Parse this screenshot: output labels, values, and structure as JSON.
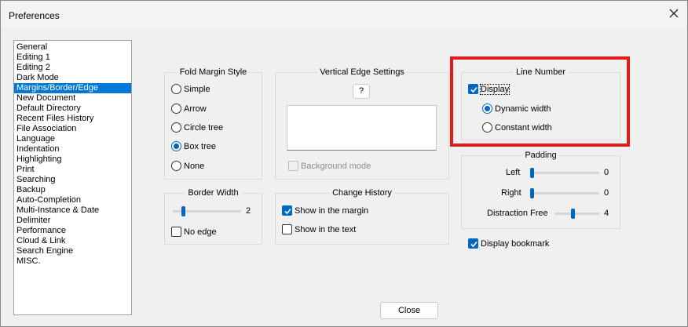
{
  "window": {
    "title": "Preferences"
  },
  "sidebar": {
    "items": [
      {
        "label": "General",
        "selected": false
      },
      {
        "label": "Editing 1",
        "selected": false
      },
      {
        "label": "Editing 2",
        "selected": false
      },
      {
        "label": "Dark Mode",
        "selected": false
      },
      {
        "label": "Margins/Border/Edge",
        "selected": true
      },
      {
        "label": "New Document",
        "selected": false
      },
      {
        "label": "Default Directory",
        "selected": false
      },
      {
        "label": "Recent Files History",
        "selected": false
      },
      {
        "label": "File Association",
        "selected": false
      },
      {
        "label": "Language",
        "selected": false
      },
      {
        "label": "Indentation",
        "selected": false
      },
      {
        "label": "Highlighting",
        "selected": false
      },
      {
        "label": "Print",
        "selected": false
      },
      {
        "label": "Searching",
        "selected": false
      },
      {
        "label": "Backup",
        "selected": false
      },
      {
        "label": "Auto-Completion",
        "selected": false
      },
      {
        "label": "Multi-Instance & Date",
        "selected": false
      },
      {
        "label": "Delimiter",
        "selected": false
      },
      {
        "label": "Performance",
        "selected": false
      },
      {
        "label": "Cloud & Link",
        "selected": false
      },
      {
        "label": "Search Engine",
        "selected": false
      },
      {
        "label": "MISC.",
        "selected": false
      }
    ]
  },
  "fold_margin": {
    "title": "Fold Margin Style",
    "options": [
      {
        "label": "Simple",
        "selected": false
      },
      {
        "label": "Arrow",
        "selected": false
      },
      {
        "label": "Circle tree",
        "selected": false
      },
      {
        "label": "Box tree",
        "selected": true
      },
      {
        "label": "None",
        "selected": false
      }
    ]
  },
  "border_width": {
    "title": "Border Width",
    "value": "2",
    "level": 0.1,
    "no_edge_label": "No edge",
    "no_edge_checked": false
  },
  "vertical_edge": {
    "title": "Vertical Edge Settings",
    "help_label": "?",
    "textarea_value": "",
    "background_mode_label": "Background mode",
    "background_mode_checked": false
  },
  "change_history": {
    "title": "Change History",
    "show_margin_label": "Show in the margin",
    "show_margin_checked": true,
    "show_text_label": "Show in the text",
    "show_text_checked": false
  },
  "line_number": {
    "title": "Line Number",
    "display_label": "Display",
    "display_checked": true,
    "dynamic_label": "Dynamic width",
    "dynamic_selected": true,
    "constant_label": "Constant width",
    "constant_selected": false
  },
  "padding": {
    "title": "Padding",
    "left_label": "Left",
    "left_value": "0",
    "left_level": 0,
    "right_label": "Right",
    "right_value": "0",
    "right_level": 0,
    "distraction_label": "Distraction Free",
    "distraction_value": "4",
    "distraction_level": 0.4
  },
  "display_bookmark": {
    "label": "Display bookmark",
    "checked": true
  },
  "footer": {
    "close_label": "Close"
  },
  "colors": {
    "accent": "#0067c0",
    "selection": "#0078d7",
    "highlight": "#e21b1b"
  }
}
